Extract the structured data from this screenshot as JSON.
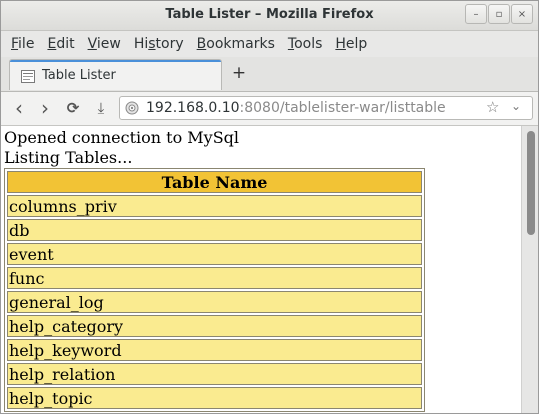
{
  "window": {
    "title": "Table Lister – Mozilla Firefox",
    "controls": [
      "–",
      "▫",
      "×"
    ]
  },
  "menubar": [
    {
      "accel": "F",
      "rest": "ile"
    },
    {
      "accel": "E",
      "rest": "dit"
    },
    {
      "accel": "V",
      "rest": "iew"
    },
    {
      "pre": "Hi",
      "accel": "s",
      "rest": "tory"
    },
    {
      "accel": "B",
      "rest": "ookmarks"
    },
    {
      "accel": "T",
      "rest": "ools"
    },
    {
      "accel": "H",
      "rest": "elp"
    }
  ],
  "tabs": [
    {
      "label": "Table Lister"
    }
  ],
  "newtab_label": "+",
  "nav": {
    "back": "‹",
    "forward": "›",
    "reload": "⟳",
    "download": "⤓",
    "url_host": "192.168.0.10",
    "url_rest": ":8080/tablelister-war/listtable",
    "star": "☆",
    "dropdown": "⌄"
  },
  "content": {
    "line1": "Opened connection to MySql",
    "line2": "Listing Tables...",
    "table": {
      "header": "Table Name",
      "rows": [
        "columns_priv",
        "db",
        "event",
        "func",
        "general_log",
        "help_category",
        "help_keyword",
        "help_relation",
        "help_topic"
      ]
    }
  },
  "colors": {
    "header_cell": "#f2c335",
    "body_cell": "#faeb90",
    "tab_accent": "#4a90d9"
  }
}
